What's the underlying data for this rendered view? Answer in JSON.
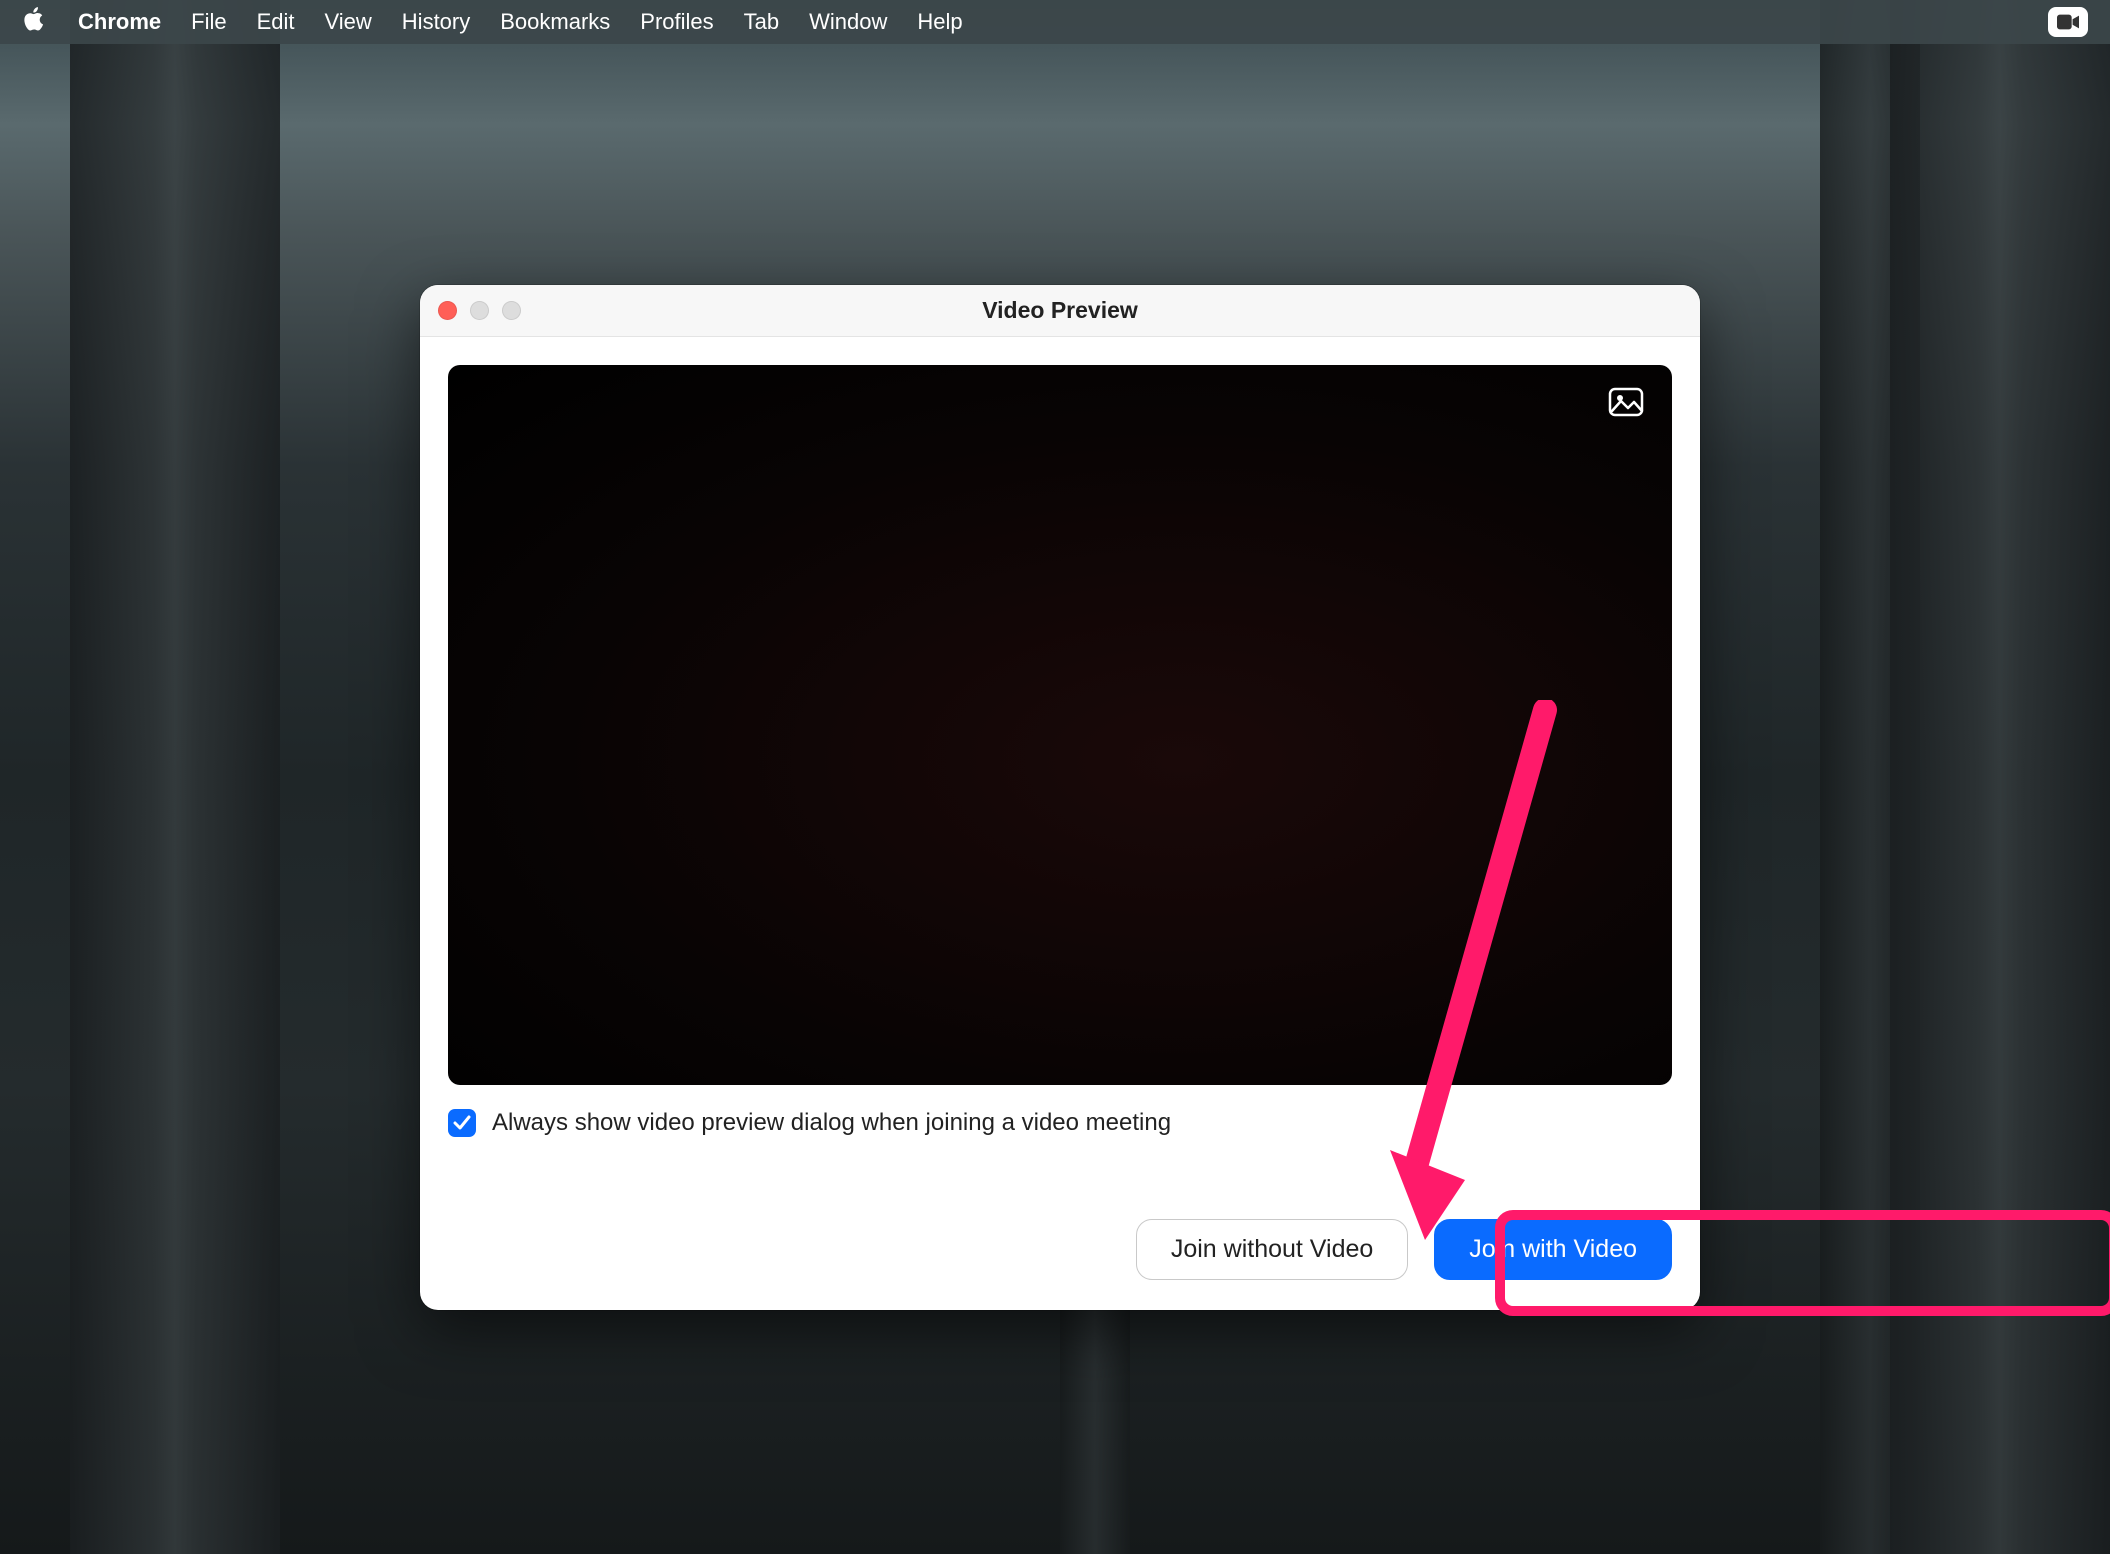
{
  "menubar": {
    "app_name": "Chrome",
    "items": [
      "File",
      "Edit",
      "View",
      "History",
      "Bookmarks",
      "Profiles",
      "Tab",
      "Window",
      "Help"
    ]
  },
  "dialog": {
    "title": "Video Preview",
    "checkbox_label": "Always show video preview dialog when joining a video meeting",
    "checkbox_checked": true,
    "buttons": {
      "secondary": "Join without Video",
      "primary": "Join with Video"
    }
  },
  "annotation": {
    "color": "#ff1a6a"
  }
}
